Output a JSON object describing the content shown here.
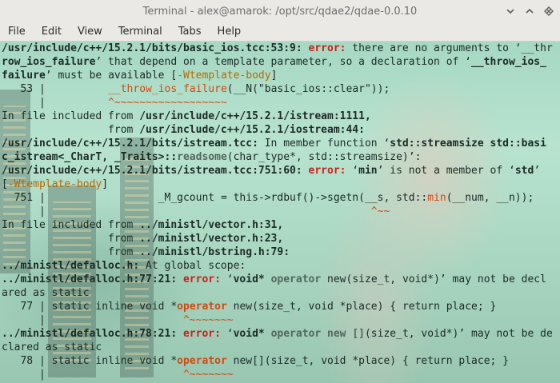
{
  "window": {
    "title": "Terminal - alex@amarok: /opt/src/qdae2/qdae-0.0.10"
  },
  "controls": {
    "minimize_icon": "▾",
    "maximize_icon": "▴",
    "close_icon": "◆"
  },
  "menu": {
    "file": "File",
    "edit": "Edit",
    "view": "View",
    "terminal": "Terminal",
    "tabs": "Tabs",
    "help": "Help"
  },
  "colors": {
    "error": "#c8201a",
    "warning": "#b46a00",
    "caret": "#d04a10"
  },
  "terminal": {
    "l01_path": "/usr/include/c++/15.2.1/bits/basic_ios.tcc:53:9:",
    "l01_err": "error:",
    "l01_msg": " there are no arguments to ‘__thr",
    "l02_a": "row_ios_failure",
    "l02_b": "’ that depend on a template parameter, so a declaration of ‘",
    "l02_c": "__throw_ios_",
    "l03_a": "failure",
    "l03_b": "’ must be available [",
    "l03_warn": "-Wtemplate-body",
    "l03_c": "]",
    "l04_num": "   53 | ",
    "l04_code_a": "         ",
    "l04_code_fn": "__throw_ios_failure",
    "l04_code_b": "(__N(\"basic_ios::clear\"));",
    "l05_bar": "      | ",
    "l05_caret": "         ^~~~~~~~~~~~~~~~~~~",
    "l06": "In file included from ",
    "l06_path": "/usr/include/c++/15.2.1/istream:1111,",
    "l07": "                 from ",
    "l07_path": "/usr/include/c++/15.2.1/iostream:44:",
    "l08_path": "/usr/include/c++/15.2.1/bits/istream.tcc:",
    "l08_msg": " In member function ‘",
    "l08_fn": "std::streamsize std::basi",
    "l09_fn": "c_istream<_CharT, _Traits>::",
    "l09_fn2": "readsome",
    "l09_msg": "(char_type*, std::streamsize)’:",
    "l10_path": "/usr/include/c++/15.2.1/bits/istream.tcc:751:60:",
    "l10_err": " error:",
    "l10_msg": " ‘",
    "l10_min": "min",
    "l10_msg2": "’ is not a member of ‘",
    "l10_std": "std",
    "l10_msg3": "’",
    "l11_a": "[",
    "l11_warn": "-Wtemplate-body",
    "l11_b": "]",
    "l12_num": "  751 | ",
    "l12_code_a": "                 _M_gcount = this->rdbuf()->sgetn(__s, std::",
    "l12_min": "min",
    "l12_code_b": "(__num, __n));",
    "l13_bar": "      | ",
    "l13_caret": "                                                   ^~~",
    "l14": "In file included from ",
    "l14_path": "../ministl/vector.h:31,",
    "l15": "                 from ",
    "l15_path": "../ministl/vector.h:23,",
    "l16": "                 from ",
    "l16_path": "../ministl/bstring.h:79:",
    "l17_path": "../ministl/defalloc.h:",
    "l17_msg": " At global scope:",
    "l18_path": "../ministl/defalloc.h:77:21:",
    "l18_err": " error:",
    "l18_a": " ‘",
    "l18_void": "void* ",
    "l18_op": "operator",
    "l18_b": " new(size_t, void*)’ may not be decl",
    "l19": "ared as static",
    "l20_num": "   77 | ",
    "l20_a": "static inline void *",
    "l20_op": "operator",
    "l20_b": " new(size_t, void *place) { return place; }",
    "l21_bar": "      | ",
    "l21_caret": "                     ^~~~~~~~",
    "l22_path": "../ministl/defalloc.h:78:21:",
    "l22_err": " error:",
    "l22_a": " ‘",
    "l22_void": "void* ",
    "l22_op": "operator new []",
    "l22_b": "(size_t, void*)’ may not be de",
    "l23": "clared as static",
    "l24_num": "   78 | ",
    "l24_a": "static inline void *",
    "l24_op": "operator",
    "l24_b": " new[](size_t, void *place) { return place; }",
    "l25_bar": "      | ",
    "l25_caret": "                     ^~~~~~~~"
  }
}
